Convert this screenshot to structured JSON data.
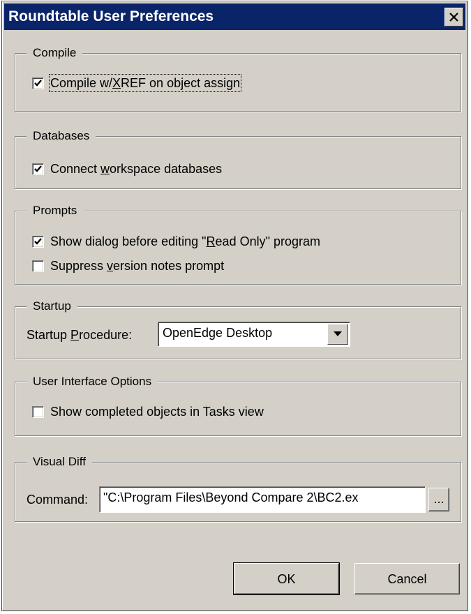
{
  "window": {
    "title": "Roundtable User Preferences"
  },
  "compile": {
    "group_label": "Compile",
    "xref_checkbox": {
      "checked": true,
      "label_pre": "Compile w/",
      "label_u": "X",
      "label_post": "REF on object assign"
    }
  },
  "databases": {
    "group_label": "Databases",
    "connect_checkbox": {
      "checked": true,
      "label_pre": "Connect ",
      "label_u": "w",
      "label_post": "orkspace databases"
    }
  },
  "prompts": {
    "group_label": "Prompts",
    "readonly_checkbox": {
      "checked": true,
      "label_pre": "Show dialog before editing \"",
      "label_u": "R",
      "label_post": "ead Only\" program"
    },
    "version_checkbox": {
      "checked": false,
      "label_pre": "Suppress ",
      "label_u": "v",
      "label_post": "ersion notes prompt"
    }
  },
  "startup": {
    "group_label": "Startup",
    "procedure_label_pre": "Startup ",
    "procedure_label_u": "P",
    "procedure_label_post": "rocedure:",
    "procedure_value": "OpenEdge Desktop"
  },
  "ui_options": {
    "group_label": "User Interface Options",
    "completed_checkbox": {
      "checked": false,
      "label": "Show completed objects in Tasks view"
    }
  },
  "visual_diff": {
    "group_label": "Visual Diff",
    "command_label": "Command:",
    "command_value": "\"C:\\Program Files\\Beyond Compare 2\\BC2.ex",
    "browse_label": "..."
  },
  "buttons": {
    "ok": "OK",
    "cancel": "Cancel"
  }
}
